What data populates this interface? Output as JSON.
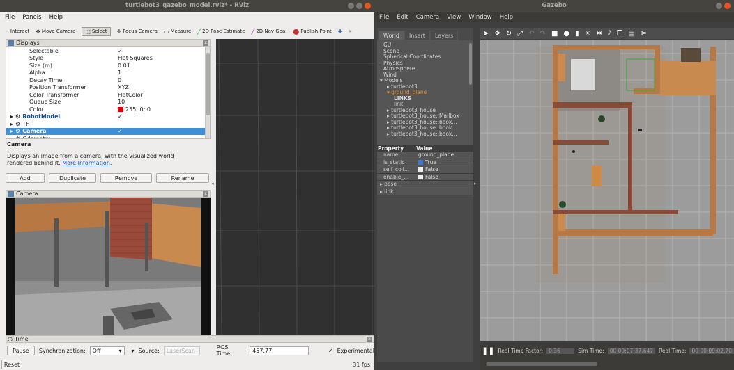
{
  "rviz": {
    "title": "turtlebot3_gazebo_model.rviz* - RViz",
    "menu": [
      "File",
      "Panels",
      "Help"
    ],
    "toolbar": {
      "interact": "Interact",
      "move_camera": "Move Camera",
      "select": "Select",
      "focus_camera": "Focus Camera",
      "measure": "Measure",
      "pose_estimate": "2D Pose Estimate",
      "nav_goal": "2D Nav Goal",
      "publish_point": "Publish Point",
      "more": "»"
    },
    "displays_panel": {
      "title": "Displays",
      "properties": [
        {
          "key": "Selectable",
          "value": "✓"
        },
        {
          "key": "Style",
          "value": "Flat Squares"
        },
        {
          "key": "Size (m)",
          "value": "0.01"
        },
        {
          "key": "Alpha",
          "value": "1"
        },
        {
          "key": "Decay Time",
          "value": "0"
        },
        {
          "key": "Position Transformer",
          "value": "XYZ"
        },
        {
          "key": "Color Transformer",
          "value": "FlatColor"
        },
        {
          "key": "Queue Size",
          "value": "10"
        },
        {
          "key": "Color",
          "value": "255; 0; 0"
        }
      ],
      "items": [
        {
          "label": "RobotModel",
          "checked": "✓"
        },
        {
          "label": "TF",
          "checked": ""
        },
        {
          "label": "Camera",
          "checked": "✓"
        },
        {
          "label": "Odometry",
          "checked": ""
        }
      ],
      "description_title": "Camera",
      "description_text": "Displays an image from a camera, with the visualized world rendered behind it.",
      "more_info": "More Information",
      "description_period": ".",
      "buttons": {
        "add": "Add",
        "duplicate": "Duplicate",
        "remove": "Remove",
        "rename": "Rename"
      }
    },
    "camera_panel": {
      "title": "Camera"
    },
    "time_panel": {
      "title": "Time",
      "pause": "Pause",
      "sync_label": "Synchronization:",
      "sync_value": "Off",
      "source_label": "Source:",
      "source_value": "LaserScan",
      "ros_time_label": "ROS Time:",
      "ros_time_value": "457.77",
      "experimental": "Experimental",
      "reset": "Reset",
      "fps": "31 fps"
    }
  },
  "gazebo": {
    "title": "Gazebo",
    "menu": [
      "File",
      "Edit",
      "Camera",
      "View",
      "Window",
      "Help"
    ],
    "tabs": [
      "World",
      "Insert",
      "Layers"
    ],
    "tree": [
      {
        "label": "GUI",
        "indent": 1
      },
      {
        "label": "Scene",
        "indent": 1
      },
      {
        "label": "Spherical Coordinates",
        "indent": 1
      },
      {
        "label": "Physics",
        "indent": 1
      },
      {
        "label": "Atmosphere",
        "indent": 1
      },
      {
        "label": "Wind",
        "indent": 1
      },
      {
        "label": "▾ Models",
        "indent": 0
      },
      {
        "label": "▸ turtlebot3",
        "indent": 2
      },
      {
        "label": "▾ ground_plane",
        "indent": 2,
        "selected": true
      },
      {
        "label": "LINKS",
        "indent": 4,
        "bold": true
      },
      {
        "label": "link",
        "indent": 4
      },
      {
        "label": "▸ turtlebot3_house",
        "indent": 2
      },
      {
        "label": "▸ turtlebot3_house::Mailbox",
        "indent": 2
      },
      {
        "label": "▸ turtlebot3_house::book...",
        "indent": 2
      },
      {
        "label": "▸ turtlebot3_house::book...",
        "indent": 2
      },
      {
        "label": "▸ turtlebot3_house::book...",
        "indent": 2
      }
    ],
    "property_header": {
      "property": "Property",
      "value": "Value"
    },
    "properties": [
      {
        "key": "name",
        "value": "ground_plane",
        "check": null
      },
      {
        "key": "is_static",
        "value": "True",
        "check": true
      },
      {
        "key": "self_coll...",
        "value": "False",
        "check": false
      },
      {
        "key": "enable_...",
        "value": "False",
        "check": false
      },
      {
        "key": "▸ pose",
        "value": "",
        "check": null,
        "full": true
      },
      {
        "key": "▸ link",
        "value": "",
        "check": null,
        "full": true
      }
    ],
    "status": {
      "pause_icon": "pause-icon",
      "rtf_label": "Real Time Factor:",
      "rtf_value": "0.36",
      "sim_time_label": "Sim Time:",
      "sim_time_value": "00 00:07:37.647",
      "real_time_label": "Real Time:",
      "real_time_value": "00 00:09:02.70"
    }
  },
  "colors": {
    "highlight": "#3f8fd6",
    "wall": "#b87844",
    "brick": "#8a4a38",
    "accent": "#e95420",
    "gazebo_bg": "#9c9c9c",
    "rviz_grid_bg": "#2f2f2f"
  }
}
